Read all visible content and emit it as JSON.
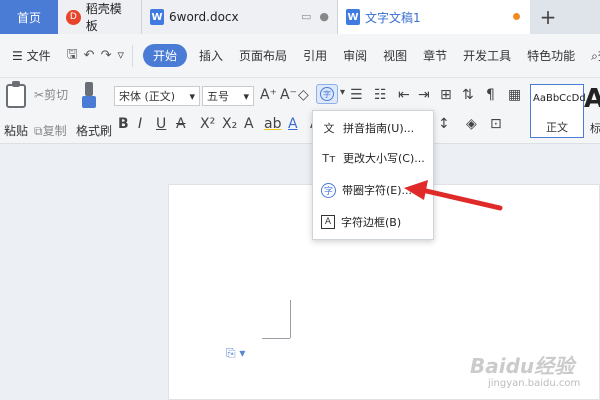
{
  "tabs": {
    "home": "首页",
    "template": "稻壳模板",
    "doc1": "6word.docx",
    "doc2": "文字文稿1",
    "plus": "+"
  },
  "menubar": {
    "file": "文件",
    "start": "开始",
    "items": [
      "插入",
      "页面布局",
      "引用",
      "审阅",
      "视图",
      "章节",
      "开发工具",
      "特色功能"
    ],
    "search": "查找"
  },
  "ribbon": {
    "paste": "粘贴",
    "cut": "剪切",
    "copy": "复制",
    "format_painter": "格式刷",
    "font_name": "宋体 (正文)",
    "font_size": "五号",
    "style_preview": "AaBbCcDd",
    "style_label": "正文",
    "style_big": "Aa",
    "style_big_label": "标"
  },
  "dropdown": {
    "items": [
      {
        "icon": "文",
        "label": "拼音指南(U)..."
      },
      {
        "icon": "Tт",
        "label": "更改大小写(C)..."
      },
      {
        "icon": "字",
        "label": "带圈字符(E)..."
      },
      {
        "icon": "A",
        "label": "字符边框(B)"
      }
    ]
  },
  "watermark": {
    "brand": "Baidu经验",
    "url": "jingyan.baidu.com"
  },
  "colors": {
    "accent": "#4a7cd6",
    "arrow": "#e02a2a",
    "tabbar": "#dfe3ea"
  }
}
